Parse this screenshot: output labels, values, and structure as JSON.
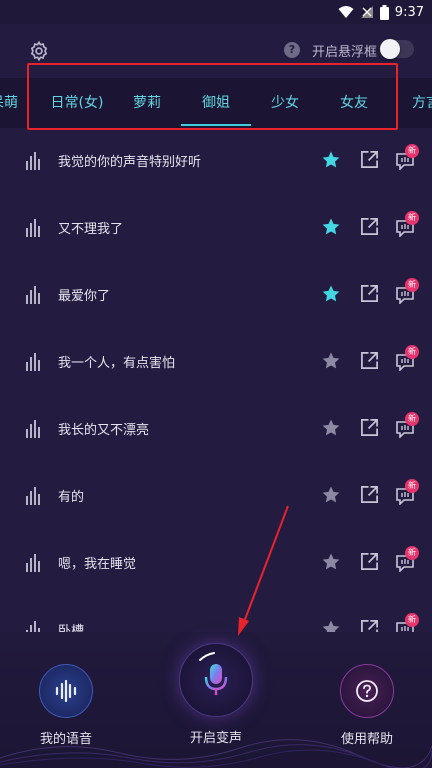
{
  "status_bar": {
    "time": "9:37"
  },
  "header": {
    "float_window_label": "开启悬浮框",
    "float_window_on": false
  },
  "tabs": [
    {
      "label": "呆萌"
    },
    {
      "label": "日常(女)"
    },
    {
      "label": "萝莉"
    },
    {
      "label": "御姐",
      "active": true
    },
    {
      "label": "少女"
    },
    {
      "label": "女友"
    },
    {
      "label": "方言"
    }
  ],
  "voice_list": [
    {
      "title": "我觉的你的声音特别好听",
      "favorited": true,
      "badge": "新"
    },
    {
      "title": "又不理我了",
      "favorited": true,
      "badge": "新"
    },
    {
      "title": "最爱你了",
      "favorited": true,
      "badge": "新"
    },
    {
      "title": "我一个人，有点害怕",
      "favorited": false,
      "badge": "新"
    },
    {
      "title": "我长的又不漂亮",
      "favorited": false,
      "badge": "新"
    },
    {
      "title": "有的",
      "favorited": false,
      "badge": "新"
    },
    {
      "title": "嗯，我在睡觉",
      "favorited": false,
      "badge": "新"
    },
    {
      "title": "卧槽",
      "favorited": false,
      "badge": "新"
    }
  ],
  "bottom_nav": {
    "my_voice": "我的语音",
    "start_voice_change": "开启变声",
    "help": "使用帮助"
  },
  "colors": {
    "background": "#231c40",
    "accent_cyan": "#3fd0dc",
    "favorite_star": "#45d6e3",
    "unfavorite_star": "#8d89a3",
    "badge_red": "#e8336c",
    "annotation_red": "#e8232c"
  },
  "icons": {
    "settings": "gear-icon",
    "help": "question-icon",
    "waveform": "waveform-icon",
    "star": "star-icon",
    "share": "share-icon",
    "message": "message-icon",
    "microphone": "microphone-icon"
  }
}
